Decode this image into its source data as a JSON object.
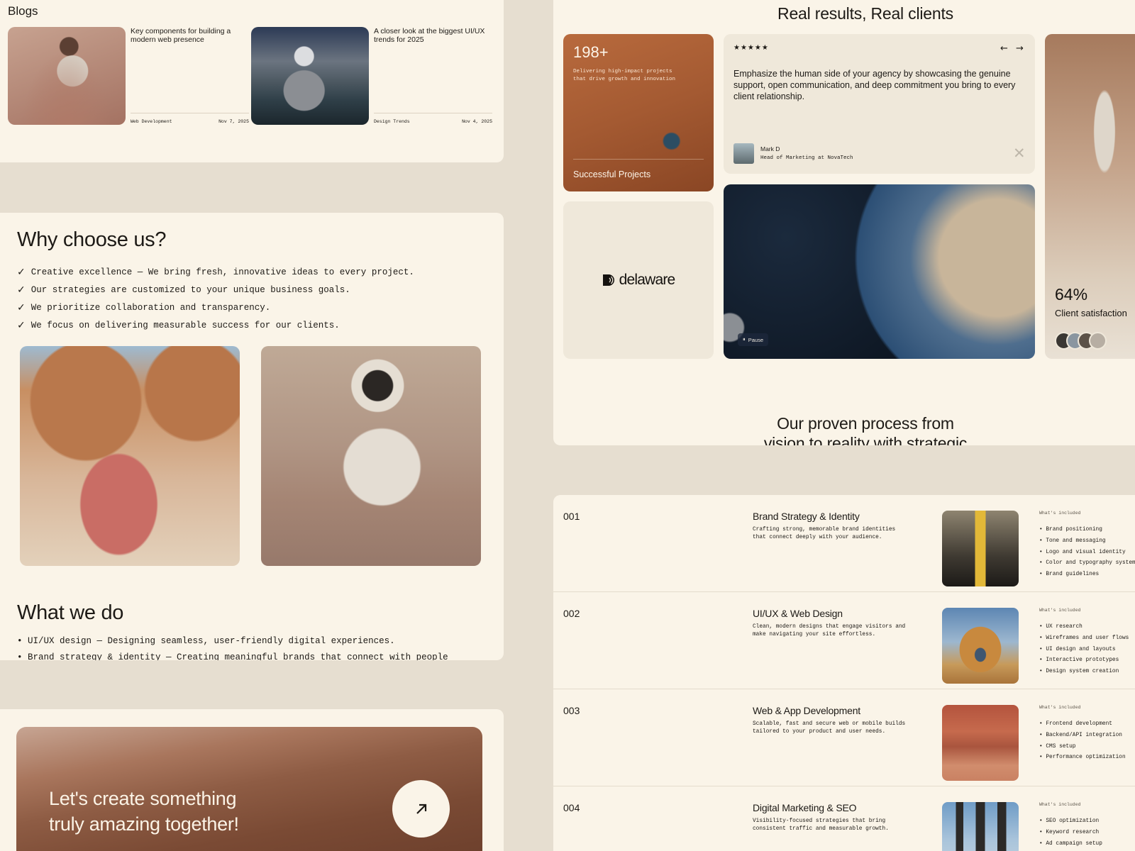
{
  "blogs": {
    "title": "Blogs",
    "posts": [
      {
        "title": "Key components for building a modern web presence",
        "category": "Web Development",
        "date": "Nov 7, 2025"
      },
      {
        "title": "A closer look at the biggest UI/UX trends for 2025",
        "category": "Design Trends",
        "date": "Nov 4, 2025"
      }
    ]
  },
  "why": {
    "title": "Why choose us?",
    "check_icon": "✓",
    "items": [
      "Creative excellence — We bring fresh, innovative ideas to every project.",
      "Our strategies are customized to your unique business goals.",
      "We prioritize collaboration and transparency.",
      "We focus on delivering measurable success for our clients."
    ]
  },
  "what_we_do": {
    "title": "What we do",
    "items": [
      "• UI/UX design — Designing seamless, user-friendly digital experiences.",
      "• Brand strategy & identity — Creating meaningful brands that connect with people"
    ]
  },
  "cta": {
    "text_line1": "Let's create something",
    "text_line2": "truly amazing together!"
  },
  "results": {
    "title": "Real results, Real clients",
    "stat": {
      "number": "198+",
      "description": "Delivering high-impact projects that drive growth and innovation",
      "label": "Successful Projects"
    },
    "client_logo": "delaware",
    "testimonial": {
      "stars": "★★★★★",
      "prev_arrow": "←",
      "next_arrow": "→",
      "quote": "Emphasize the human side of your agency by showcasing the genuine support, open communication, and deep commitment you bring to every client relationship.",
      "author": "Mark D",
      "role": "Head of Marketing at NovaTech"
    },
    "video": {
      "pause_label": "Pause",
      "pause_icon": "⏸"
    },
    "satisfaction": {
      "number": "64%",
      "label": "Client satisfaction"
    },
    "process_line1": "Our proven process from",
    "process_line2": "vision to reality with strategic"
  },
  "services": {
    "included_label": "What's included",
    "rows": [
      {
        "number": "001",
        "title": "Brand Strategy & Identity",
        "description": "Crafting strong, memorable brand identities that connect deeply with your audience.",
        "items": [
          "• Brand positioning",
          "• Tone and messaging",
          "• Logo and visual identity",
          "• Color and typography system",
          "• Brand guidelines"
        ]
      },
      {
        "number": "002",
        "title": "UI/UX & Web Design",
        "description": "Clean, modern designs that engage visitors and make navigating your site effortless.",
        "items": [
          "• UX research",
          "• Wireframes and user flows",
          "• UI design and layouts",
          "• Interactive prototypes",
          "• Design system creation"
        ]
      },
      {
        "number": "003",
        "title": "Web & App Development",
        "description": "Scalable, fast and secure web or mobile builds tailored to your product and user needs.",
        "items": [
          "• Frontend development",
          "• Backend/API integration",
          "• CMS setup",
          "• Performance optimization"
        ]
      },
      {
        "number": "004",
        "title": "Digital Marketing & SEO",
        "description": "Visibility-focused strategies that bring consistent traffic and measurable growth.",
        "items": [
          "• SEO optimization",
          "• Keyword research",
          "• Ad campaign setup"
        ]
      }
    ]
  },
  "colors": {
    "page_bg": "#e6ded0",
    "panel_bg": "#faf4e8",
    "card_bg": "#efe8da",
    "text": "#1d1a16"
  }
}
